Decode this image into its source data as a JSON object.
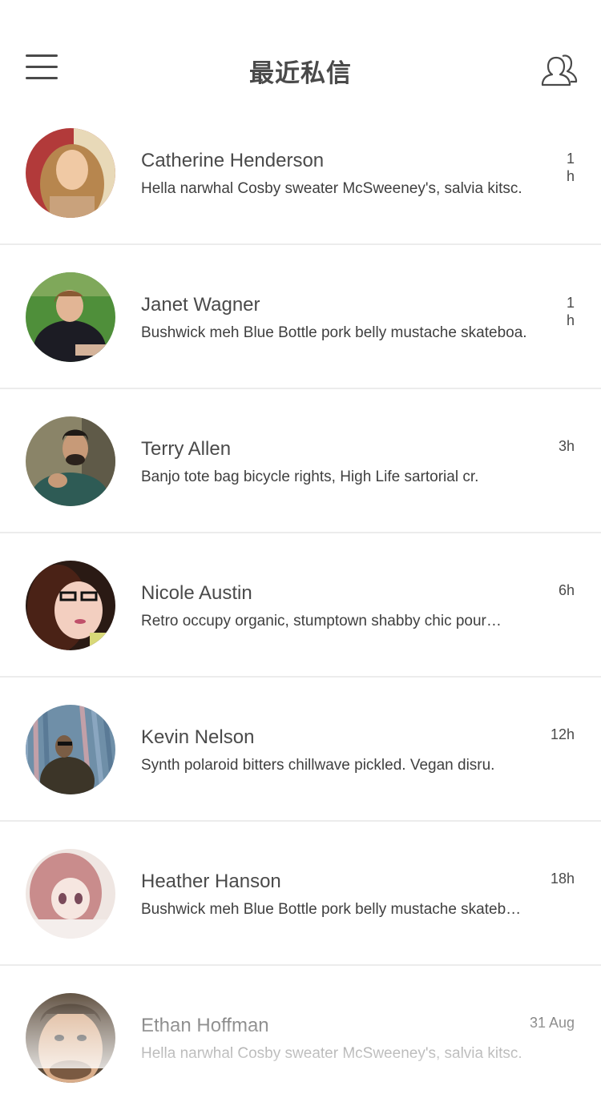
{
  "header": {
    "title": "最近私信",
    "menu_icon": "hamburger-menu-icon",
    "contacts_icon": "contacts-person-icon"
  },
  "conversations": [
    {
      "name": "Catherine Henderson",
      "preview": "Hella narwhal Cosby sweater McSweeney's, salvia kitsc.",
      "time": "1h"
    },
    {
      "name": "Janet Wagner",
      "preview": "Bushwick meh Blue Bottle pork belly mustache skateboa.",
      "time": "1h"
    },
    {
      "name": "Terry Allen",
      "preview": "Banjo tote bag bicycle rights, High Life sartorial cr.",
      "time": "3h"
    },
    {
      "name": "Nicole Austin",
      "preview": "Retro occupy organic, stumptown shabby chic pour…",
      "time": "6h"
    },
    {
      "name": "Kevin Nelson",
      "preview": "Synth polaroid bitters chillwave pickled. Vegan disru.",
      "time": "12h"
    },
    {
      "name": "Heather Hanson",
      "preview": "Bushwick meh Blue Bottle pork belly mustache skateb…",
      "time": "18h"
    },
    {
      "name": "Ethan Hoffman",
      "preview": "Hella narwhal Cosby sweater McSweeney's, salvia kitsc.",
      "time": "31 Aug"
    }
  ]
}
